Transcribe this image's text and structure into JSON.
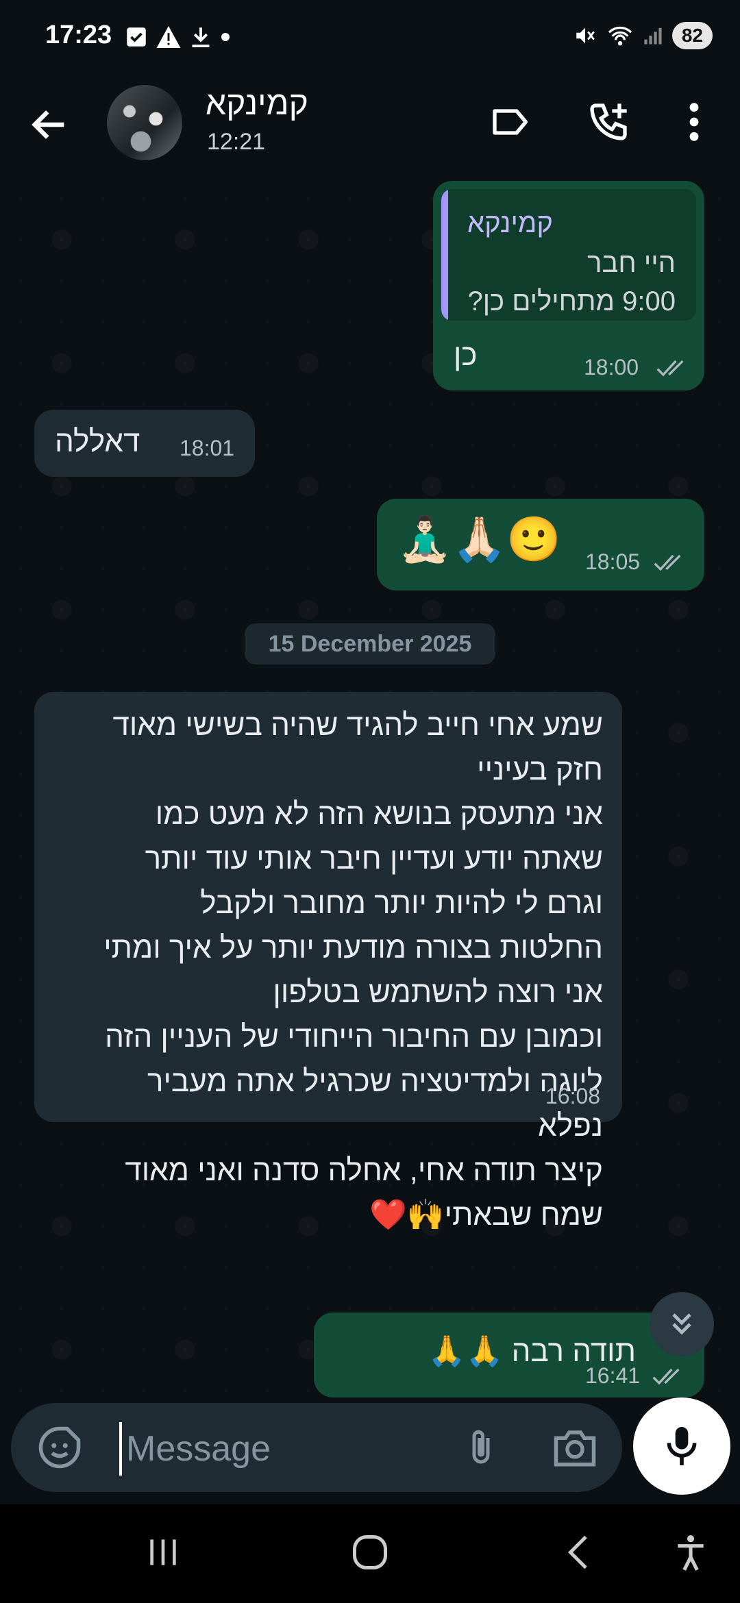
{
  "status_bar": {
    "time": "17:23",
    "battery": "82"
  },
  "header": {
    "contact_name": "קמינקא",
    "subtitle": "12:21"
  },
  "messages": [
    {
      "direction": "out",
      "quote": {
        "author": "קמינקא",
        "line1": "היי חבר",
        "line2": "9:00 מתחילים כן?"
      },
      "text": "כן",
      "time": "18:00",
      "status": "read"
    },
    {
      "direction": "in",
      "text": "דאללה",
      "time": "18:01"
    },
    {
      "direction": "out",
      "text": "🧘🏻‍♂️🙏🏻🙂",
      "time": "18:05",
      "status": "read"
    },
    {
      "direction": "in",
      "lines": [
        "שמע אחי חייב להגיד שהיה בשישי מאוד",
        "חזק בעיניי",
        "אני מתעסק בנושא הזה לא מעט כמו",
        "שאתה יודע ועדיין חיבר אותי עוד יותר",
        "וגרם לי להיות יותר מחובר ולקבל",
        "החלטות בצורה מודעת יותר על איך ומתי",
        "אני רוצה להשתמש בטלפון",
        "וכמובן עם החיבור הייחודי של העניין הזה",
        "ליוגה ולמדיטציה שכרגיל אתה מעביר",
        "נפלא",
        "קיצר תודה אחי, אחלה סדנה ואני מאוד",
        "שמח שבאתי🙌❤️"
      ],
      "time": "16:08"
    },
    {
      "direction": "out",
      "text": "תודה רבה 🙏🙏",
      "time": "16:41",
      "status": "read"
    }
  ],
  "date_separator": "15 December 2025",
  "composer": {
    "placeholder": "Message"
  },
  "icons": {
    "back": "arrow-left-icon",
    "label": "label-icon",
    "add_call": "call-add-icon",
    "menu": "more-vert-icon",
    "emoji": "sticker-icon",
    "attach": "paperclip-icon",
    "camera": "camera-icon",
    "mic": "mic-icon",
    "scroll": "chevron-double-down-icon"
  },
  "colors": {
    "accent_out": "#144d37",
    "incoming": "#202c33",
    "quote_name": "#c3b9ff"
  }
}
